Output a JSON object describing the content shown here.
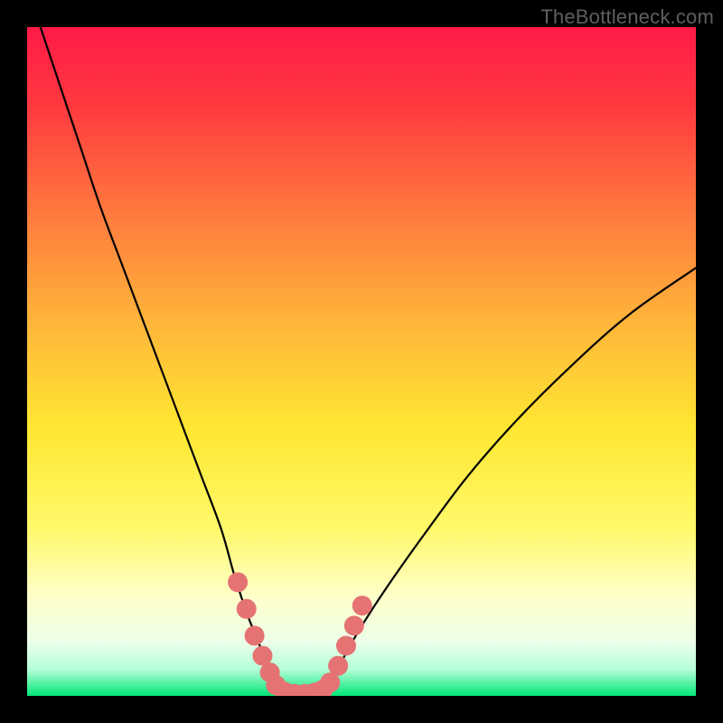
{
  "watermark": "TheBottleneck.com",
  "chart_data": {
    "type": "line",
    "title": "",
    "xlabel": "",
    "ylabel": "",
    "x_range": [
      0,
      100
    ],
    "y_range": [
      0,
      100
    ],
    "grid": false,
    "colors": {
      "gradient_top": "#ff1744",
      "gradient_upper_mid": "#ff8a3d",
      "gradient_mid": "#ffe732",
      "gradient_lower_mid": "#fffde0",
      "gradient_bottom": "#00e676",
      "curve": "#000000",
      "markers": "#e57373"
    },
    "series": [
      {
        "name": "left-curve",
        "x": [
          2,
          5,
          8,
          11,
          14,
          17,
          20,
          23,
          26,
          29,
          31,
          33,
          35,
          36.5,
          37.4
        ],
        "y": [
          100,
          91,
          82,
          73,
          65,
          57,
          49,
          41,
          33,
          25,
          18,
          12,
          7,
          3,
          1
        ]
      },
      {
        "name": "right-curve",
        "x": [
          44.5,
          46,
          48,
          51,
          55,
          60,
          66,
          73,
          81,
          90,
          100
        ],
        "y": [
          1,
          3,
          7,
          12,
          18,
          25,
          33,
          41,
          49,
          57,
          64
        ]
      },
      {
        "name": "valley-flat",
        "x": [
          37.4,
          38,
          39,
          40,
          41,
          42,
          43,
          44,
          44.5
        ],
        "y": [
          1,
          0.6,
          0.4,
          0.3,
          0.3,
          0.4,
          0.6,
          0.8,
          1
        ]
      }
    ],
    "markers": {
      "name": "valley-markers",
      "points": [
        {
          "x": 31.5,
          "y": 17
        },
        {
          "x": 32.8,
          "y": 13
        },
        {
          "x": 34.0,
          "y": 9
        },
        {
          "x": 35.2,
          "y": 6
        },
        {
          "x": 36.3,
          "y": 3.5
        },
        {
          "x": 37.2,
          "y": 1.6
        },
        {
          "x": 38.5,
          "y": 0.6
        },
        {
          "x": 40.0,
          "y": 0.3
        },
        {
          "x": 41.5,
          "y": 0.3
        },
        {
          "x": 43.0,
          "y": 0.5
        },
        {
          "x": 44.2,
          "y": 0.9
        },
        {
          "x": 45.3,
          "y": 2.0
        },
        {
          "x": 46.5,
          "y": 4.5
        },
        {
          "x": 47.7,
          "y": 7.5
        },
        {
          "x": 48.9,
          "y": 10.5
        },
        {
          "x": 50.1,
          "y": 13.5
        }
      ],
      "radius": 11
    }
  }
}
